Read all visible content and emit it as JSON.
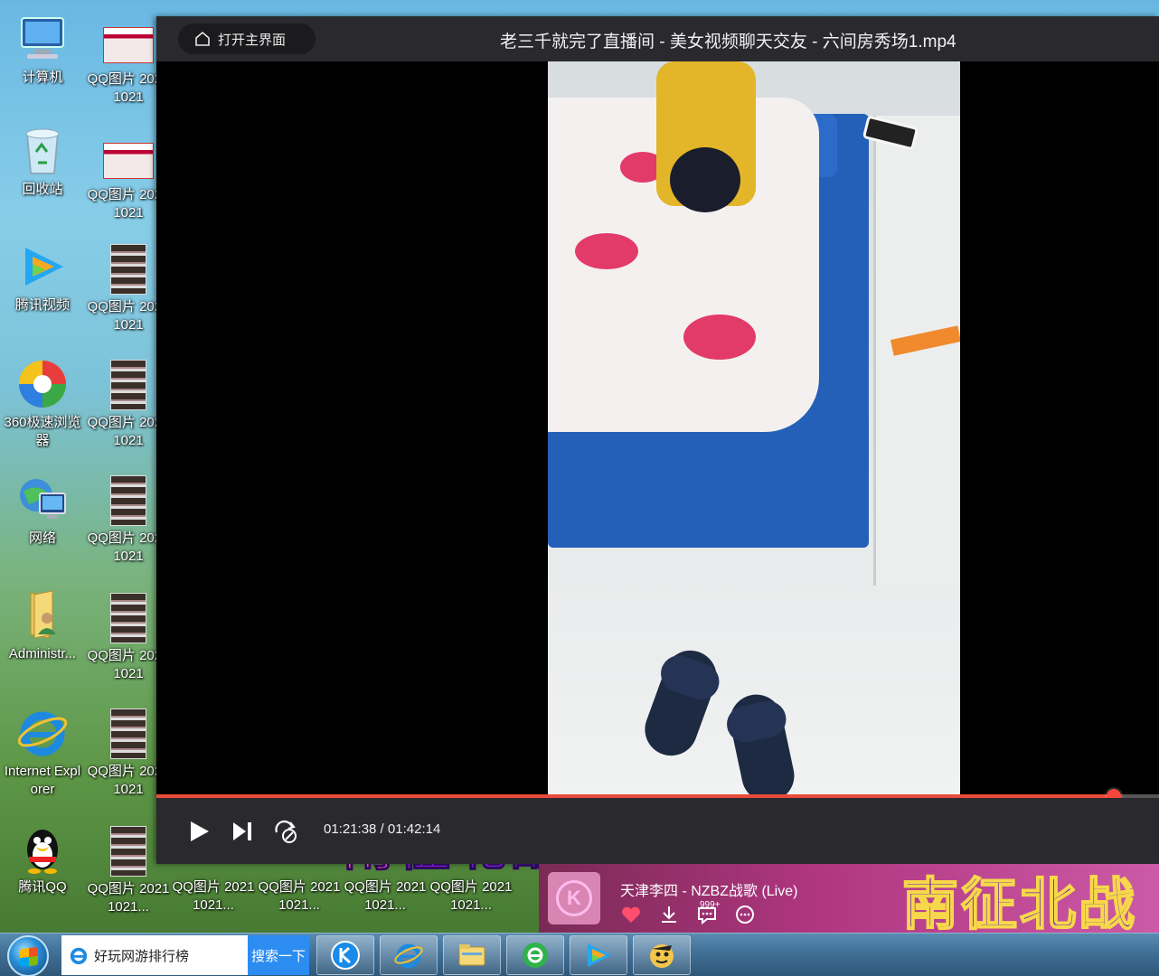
{
  "desktop": {
    "left_column": [
      {
        "label": "计算机",
        "icon": "computer-icon"
      },
      {
        "label": "回收站",
        "icon": "recycle-bin-icon"
      },
      {
        "label": "腾讯视频",
        "icon": "tencent-video-icon"
      },
      {
        "label": "360极速浏览器",
        "icon": "360-browser-icon"
      },
      {
        "label": "网络",
        "icon": "network-icon"
      },
      {
        "label": "Administr...",
        "icon": "user-folder-icon"
      },
      {
        "label": "Internet Explorer",
        "icon": "ie-icon"
      },
      {
        "label": "腾讯QQ",
        "icon": "qq-penguin-icon"
      }
    ],
    "qq_images_column": [
      {
        "label": "QQ图片 20211021"
      },
      {
        "label": "QQ图片 20211021"
      },
      {
        "label": "QQ图片 20211021"
      },
      {
        "label": "QQ图片 20211021"
      },
      {
        "label": "QQ图片 20211021"
      },
      {
        "label": "QQ图片 20211021"
      },
      {
        "label": "QQ图片 20211021"
      },
      {
        "label": "QQ图片 20211021..."
      }
    ],
    "qq_images_row": [
      {
        "label": "QQ图片 20211021..."
      },
      {
        "label": "QQ图片 20211021..."
      },
      {
        "label": "QQ图片 20211021..."
      },
      {
        "label": "QQ图片 20211021..."
      }
    ]
  },
  "player": {
    "home_label": "打开主界面",
    "title": "老三千就完了直播间 - 美女视频聊天交友 - 六间房秀场1.mp4",
    "lyric_overlay": "南征北战  不服就干",
    "current_time": "01:21:38",
    "total_time": "01:42:14",
    "time_separator": " / ",
    "progress": 0.955
  },
  "music": {
    "song": "天津李四 - NZBZ战歌 (Live)",
    "comment_badge": "999+",
    "big_lyric": "南征北战",
    "album_glyph": "K"
  },
  "taskbar": {
    "search_text": "好玩网游排行榜",
    "search_button": "搜索一下"
  },
  "colors": {
    "progress_accent": "#ea4a3a",
    "player_chrome": "#2a2a2e",
    "search_button": "#2d8cf0"
  }
}
